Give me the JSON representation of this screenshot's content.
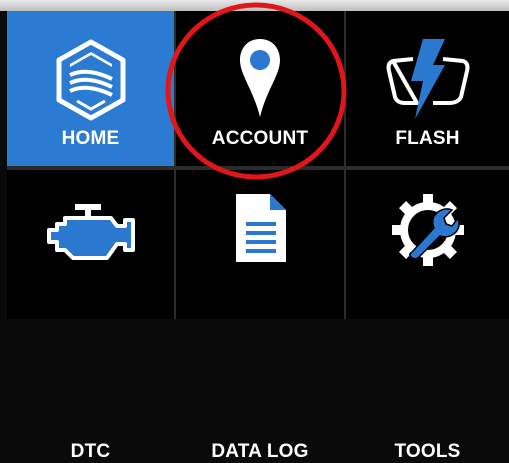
{
  "menu": {
    "tiles": [
      {
        "label": "HOME",
        "icon": "home-hexagon-icon",
        "active": true
      },
      {
        "label": "ACCOUNT",
        "icon": "location-pin-icon",
        "active": false
      },
      {
        "label": "FLASH",
        "icon": "flash-icon",
        "active": false
      },
      {
        "label": "DTC",
        "icon": "engine-icon",
        "active": false
      },
      {
        "label": "DATA LOG",
        "icon": "document-icon",
        "active": false
      },
      {
        "label": "TOOLS",
        "icon": "wrench-gear-icon",
        "active": false
      }
    ]
  },
  "annotation": {
    "type": "red-circle-highlight",
    "target": "ACCOUNT",
    "color": "#e0161b"
  },
  "colors": {
    "accent": "#2b7bd3",
    "background": "#000000",
    "icon_blue": "#2a78d0"
  }
}
